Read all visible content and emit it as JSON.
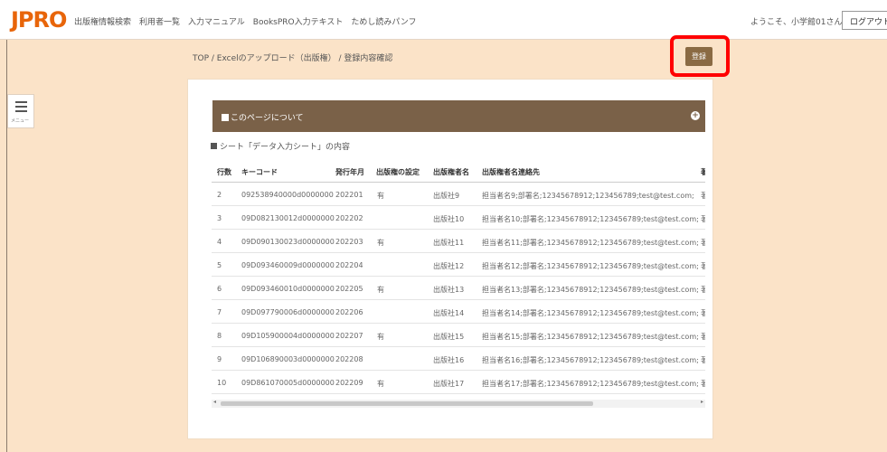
{
  "header": {
    "logo": "JPRO",
    "nav": [
      "出版権情報検索",
      "利用者一覧",
      "入力マニュアル",
      "BooksPRO入力テキスト",
      "ためし読みパンフ"
    ],
    "welcome": "ようこそ、小学館01さん",
    "logout": "ログアウト"
  },
  "sidebar": {
    "menu_label": "メニュー"
  },
  "breadcrumb": "TOP / Excelのアップロード（出版権） / 登録内容確認",
  "register_button": "登録",
  "about": {
    "label": "このページについて"
  },
  "sheet_title": "シート「データ入力シート」の内容",
  "table": {
    "headers": [
      "行数",
      "キーコード",
      "発行年月",
      "出版権の設定",
      "出版権者名",
      "出版権者名連絡先",
      "著"
    ],
    "rows": [
      [
        "2",
        "092538940000d0000000",
        "202201",
        "有",
        "出版社9",
        "担当者名9;部署名;12345678912;123456789;test@test.com;",
        "著"
      ],
      [
        "3",
        "09D082130012d0000000",
        "202202",
        "",
        "出版社10",
        "担当者名10;部署名;12345678912;123456789;test@test.com;",
        "著"
      ],
      [
        "4",
        "09D090130023d0000000",
        "202203",
        "有",
        "出版社11",
        "担当者名11;部署名;12345678912;123456789;test@test.com;",
        "著"
      ],
      [
        "5",
        "09D093460009d0000000",
        "202204",
        "",
        "出版社12",
        "担当者名12;部署名;12345678912;123456789;test@test.com;",
        "著"
      ],
      [
        "6",
        "09D093460010d0000000",
        "202205",
        "有",
        "出版社13",
        "担当者名13;部署名;12345678912;123456789;test@test.com;",
        "著"
      ],
      [
        "7",
        "09D097790006d0000000",
        "202206",
        "",
        "出版社14",
        "担当者名14;部署名;12345678912;123456789;test@test.com;",
        "著"
      ],
      [
        "8",
        "09D105900004d0000000",
        "202207",
        "有",
        "出版社15",
        "担当者名15;部署名;12345678912;123456789;test@test.com;",
        "著"
      ],
      [
        "9",
        "09D106890003d0000000",
        "202208",
        "",
        "出版社16",
        "担当者名16;部署名;12345678912;123456789;test@test.com;",
        "著"
      ],
      [
        "10",
        "09D861070005d0000000",
        "202209",
        "有",
        "出版社17",
        "担当者名17;部署名;12345678912;123456789;test@test.com;",
        "著"
      ]
    ]
  },
  "colors": {
    "background": "#fbe3c8",
    "accent": "#7a6148",
    "button": "#8a6a43",
    "highlight": "#ff0000",
    "logo": "#e8650a"
  }
}
